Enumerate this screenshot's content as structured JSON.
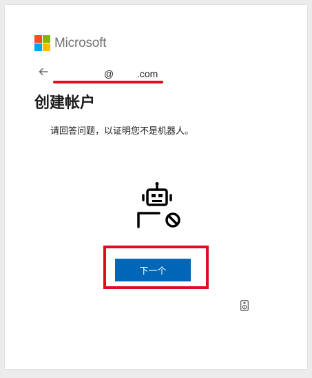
{
  "brand": {
    "name": "Microsoft",
    "colors": [
      "#f25022",
      "#7fba00",
      "#00a4ef",
      "#ffb900"
    ]
  },
  "identity": {
    "email_user": "@",
    "email_domain": ".com",
    "back_icon": "arrow-left-icon"
  },
  "main": {
    "title": "创建帐户",
    "subtitle": "请回答问题，以证明您不是机器人。",
    "illustration_icon": "robot-blocked-icon",
    "next_label": "下一个",
    "audio_icon": "speaker-icon"
  },
  "colors": {
    "primary_button": "#0067b8",
    "annotation_red": "#e10b1f"
  }
}
